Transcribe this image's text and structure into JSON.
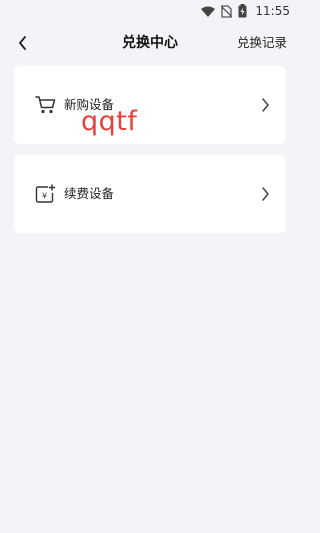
{
  "status_bar": {
    "time": "11:55",
    "icons": [
      "wifi-icon",
      "no-sim-icon",
      "battery-charging-icon"
    ]
  },
  "nav": {
    "back_icon": "chevron-left-icon",
    "title": "兑换中心",
    "records_link": "兑换记录"
  },
  "items": [
    {
      "label": "新购设备",
      "icon": "shopping-cart-icon",
      "chevron": "chevron-right-icon"
    },
    {
      "label": "续费设备",
      "icon": "yen-renew-icon",
      "chevron": "chevron-right-icon"
    }
  ],
  "overlay": {
    "text": "qqtf",
    "color": "#e8413b"
  },
  "colors": {
    "background": "#f4f4f8",
    "card": "#ffffff",
    "text": "#222222"
  }
}
